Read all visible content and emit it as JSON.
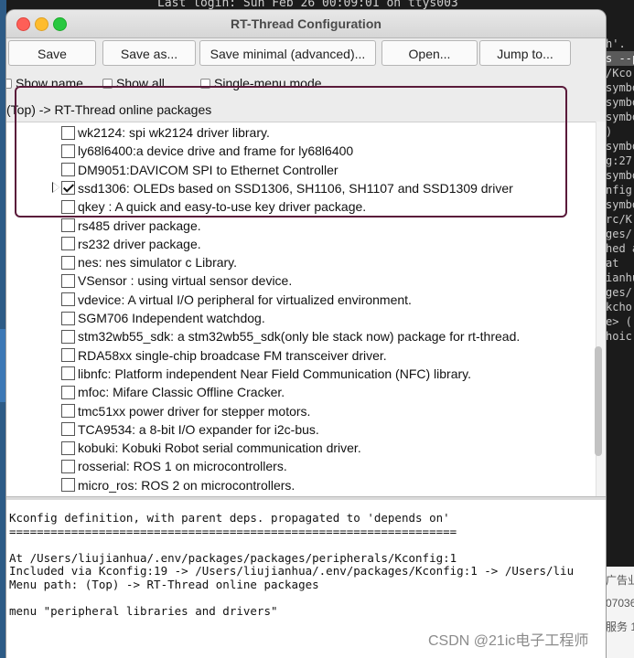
{
  "terminal": {
    "top_line": "Last login: Sun Feb 26 00:09:01 on ttys003",
    "right_fragments": [
      "",
      "h'.",
      "s --p",
      "",
      "/Kco",
      "symbo",
      "",
      "symbo",
      "",
      "symbo",
      ")",
      "symbo",
      "g:27",
      "symbo",
      "nfig",
      "symbo",
      "",
      "rc/K",
      "",
      "ges/",
      "hed a",
      "",
      " at ",
      "",
      "ianhu",
      "ges/",
      "",
      "kcho",
      "",
      "e> (",
      "",
      "hoic"
    ],
    "bottom_right": [
      "广告业",
      "07036",
      "服务 1"
    ]
  },
  "window": {
    "title": "RT-Thread Configuration",
    "toolbar": {
      "save": "Save",
      "save_as": "Save as...",
      "save_minimal": "Save minimal (advanced)...",
      "open": "Open...",
      "jump_to": "Jump to..."
    },
    "options": {
      "show_name": "Show name",
      "show_all": "Show all",
      "single_menu": "Single-menu mode"
    },
    "path": "(Top) -> RT-Thread online packages",
    "items": [
      {
        "label": "wk2124: spi wk2124 driver library.",
        "checked": false
      },
      {
        "label": "ly68l6400:a device drive and frame for ly68l6400",
        "checked": false
      },
      {
        "label": "DM9051:DAVICOM SPI to Ethernet Controller",
        "checked": false
      },
      {
        "label": "ssd1306: OLEDs based on SSD1306, SH1106, SH1107 and SSD1309 driver",
        "checked": true
      },
      {
        "label": "qkey : A quick and easy-to-use key driver package.",
        "checked": false
      },
      {
        "label": "rs485 driver package.",
        "checked": false
      },
      {
        "label": "rs232 driver package.",
        "checked": false
      },
      {
        "label": "nes: nes simulator c Library.",
        "checked": false
      },
      {
        "label": "VSensor : using virtual sensor device.",
        "checked": false
      },
      {
        "label": "vdevice: A virtual I/O peripheral for virtualized environment.",
        "checked": false
      },
      {
        "label": "SGM706 Independent watchdog.",
        "checked": false
      },
      {
        "label": "stm32wb55_sdk: a stm32wb55_sdk(only ble stack now) package for rt-thread.",
        "checked": false
      },
      {
        "label": "RDA58xx single-chip broadcase FM transceiver driver.",
        "checked": false
      },
      {
        "label": "libnfc: Platform independent Near Field Communication (NFC) library.",
        "checked": false
      },
      {
        "label": "mfoc: Mifare Classic Offline Cracker.",
        "checked": false
      },
      {
        "label": "tmc51xx power driver for stepper motors.",
        "checked": false
      },
      {
        "label": "TCA9534: a 8-bit I/O expander for i2c-bus.",
        "checked": false
      },
      {
        "label": "kobuki: Kobuki Robot serial communication driver.",
        "checked": false
      },
      {
        "label": "rosserial: ROS 1 on microcontrollers.",
        "checked": false
      },
      {
        "label": "micro_ros: ROS 2 on microcontrollers.",
        "checked": false
      }
    ],
    "info_lines": [
      "Kconfig definition, with parent deps. propagated to 'depends on'",
      "=================================================================",
      "",
      "At /Users/liujianhua/.env/packages/packages/peripherals/Kconfig:1",
      "Included via Kconfig:19 -> /Users/liujianhua/.env/packages/Kconfig:1 -> /Users/liu",
      "Menu path: (Top) -> RT-Thread online packages",
      "",
      "menu \"peripheral libraries and drivers\""
    ]
  },
  "watermark": "CSDN @21ic电子工程师",
  "colors": {
    "highlight_border": "#5a1a3a",
    "window_bg": "#ececec"
  }
}
